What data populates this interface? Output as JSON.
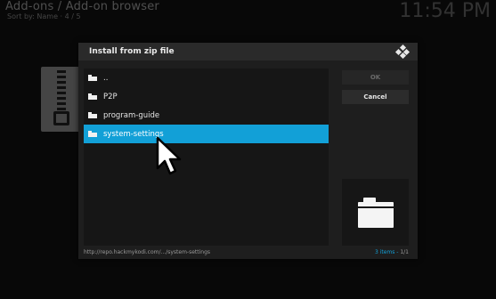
{
  "background": {
    "breadcrumb": "Add-ons / Add-on browser",
    "sort_info": "Sort by: Name · 4 / 5",
    "clock": "11:54 PM"
  },
  "dialog": {
    "title": "Install from zip file",
    "items": [
      {
        "label": "..",
        "icon": "parent-folder-icon",
        "selected": false
      },
      {
        "label": "P2P",
        "icon": "folder-icon",
        "selected": false
      },
      {
        "label": "program-guide",
        "icon": "folder-icon",
        "selected": false
      },
      {
        "label": "system-settings",
        "icon": "folder-icon",
        "selected": true
      }
    ],
    "ok_label": "OK",
    "cancel_label": "Cancel",
    "path": "http://repo.hackmykodi.com/.../system-settings",
    "item_count_text": "3 items - ",
    "page_text": "1/1"
  },
  "colors": {
    "accent": "#12a0d7",
    "dialog_bg": "#1e1e1e",
    "header_bg": "#2a2a2a"
  }
}
